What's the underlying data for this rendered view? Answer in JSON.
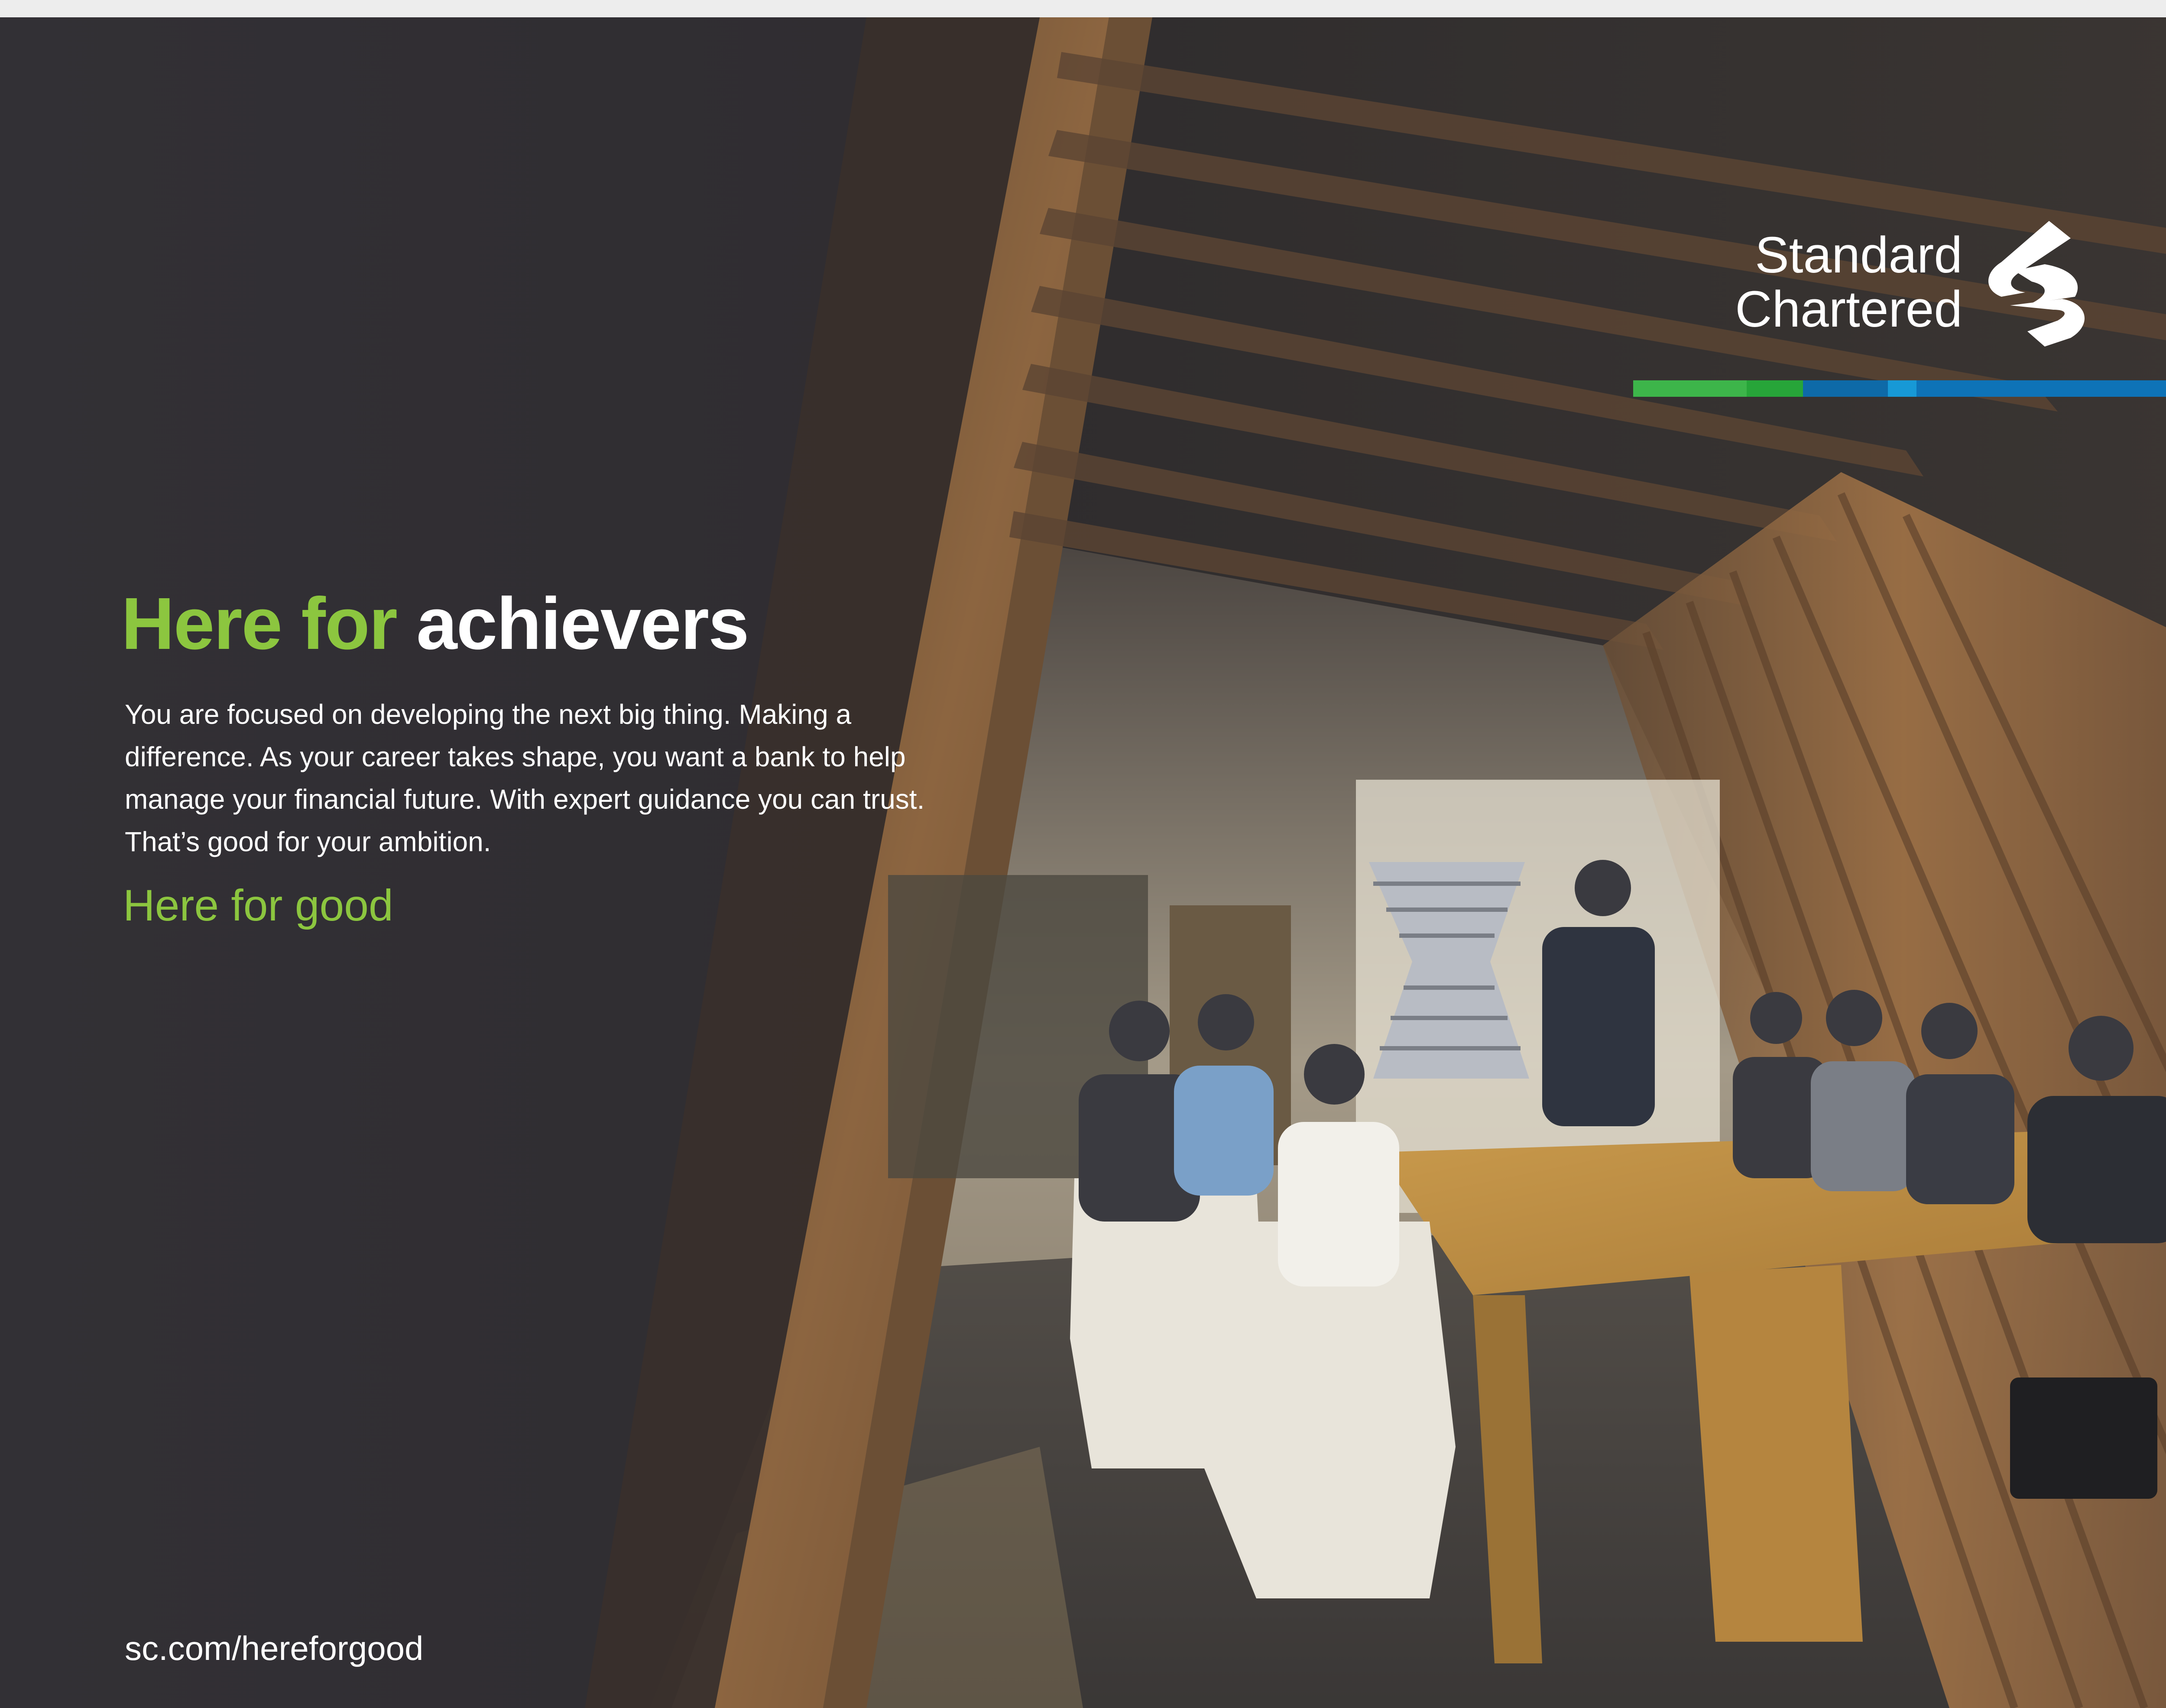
{
  "logo": {
    "line1": "Standard",
    "line2": "Chartered",
    "mark_icon": "standard-chartered-mark-icon"
  },
  "brand_bar": {
    "colors": [
      "#3db54a",
      "#27a539",
      "#0e6aa8",
      "#1799d6",
      "#0e73b7"
    ]
  },
  "headline": {
    "part1": "Here for ",
    "part2": "achievers"
  },
  "body": {
    "lines": [
      "You are focused on developing the next big thing. Making a",
      "difference. As your career takes shape, you want a bank to help",
      "manage your financial future. With expert guidance you can trust.",
      "That’s good for your ambition."
    ]
  },
  "tagline": "Here for good",
  "url": "sc.com/hereforgood",
  "colors": {
    "accent_green": "#8cc63f",
    "background_dark": "#2b2a2e",
    "wood": "#b07a3e",
    "table": "#c79a48"
  }
}
